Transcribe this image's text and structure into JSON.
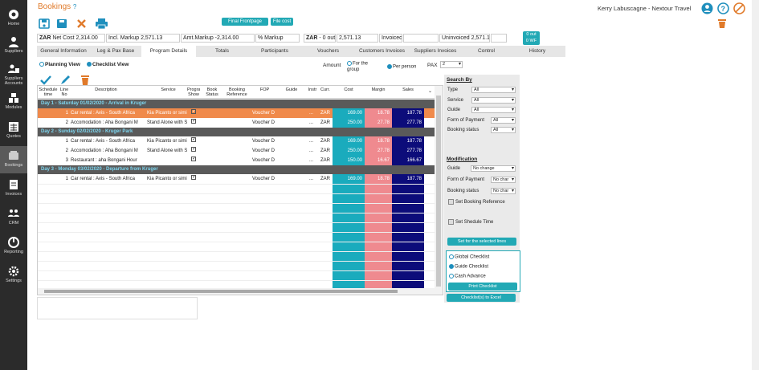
{
  "sidebar": {
    "items": [
      {
        "label": "Home",
        "icon": "home-icon"
      },
      {
        "label": "Suppliers",
        "icon": "suppliers-icon"
      },
      {
        "label": "Suppliers Accounts",
        "icon": "accounts-icon"
      },
      {
        "label": "Modules",
        "icon": "modules-icon"
      },
      {
        "label": "Quotes",
        "icon": "quotes-icon"
      },
      {
        "label": "Bookings",
        "icon": "bookings-icon"
      },
      {
        "label": "Invoices",
        "icon": "invoices-icon"
      },
      {
        "label": "CRM",
        "icon": "crm-icon"
      },
      {
        "label": "Reporting",
        "icon": "reporting-icon"
      },
      {
        "label": "Settings",
        "icon": "settings-icon"
      }
    ]
  },
  "header": {
    "title": "Bookings",
    "help": "?",
    "user": "Kerry Labuscagne - Nextour Travel",
    "final_frontpage": "Final Frontpage",
    "file_cost": "File cost"
  },
  "summary": {
    "currency": "ZAR",
    "net_cost": "Net Cost 2,314.00",
    "incl_markup": "Incl. Markup 2,571.13",
    "amt_markup": "Amt.Markup -2,314.00",
    "pct_markup": "% Markup",
    "currency2": "ZAR",
    "out": "- 0 out",
    "amount": "2,571.13",
    "invoiced": "Invoiced",
    "uninvoiced": "Uninvoiced 2,571.13",
    "badge1": "0 out",
    "badge2": "0 WF"
  },
  "tabs": [
    "General Information",
    "Leg & Pax Base",
    "Program Details",
    "Totals",
    "Participants",
    "Vouchers",
    "Customers Invoices",
    "Suppliers Invoices",
    "Control",
    "History"
  ],
  "options": {
    "planning": "Planning View",
    "checklist": "Checklist View",
    "amount": "Amount",
    "for_group": "For the group",
    "per_person": "Per person",
    "pax_label": "PAX",
    "pax_value": "2"
  },
  "grid": {
    "headers": {
      "sched": "Schedule time",
      "line": "Line No",
      "desc": "Description",
      "service": "Service",
      "program": "Program Show",
      "book": "Book Status",
      "ref": "Booking Reference",
      "fop": "FOP",
      "guide": "Guide",
      "instr": "Instr",
      "curr": "Curr.",
      "cost": "Cost",
      "margin": "Margin",
      "sales": "Sales"
    },
    "days": [
      {
        "title": "Day 1 - Saturday 01/02/2020 - Arrival in Kruger",
        "rows": [
          {
            "line": "1",
            "desc": "Car rental : Avis - South Africa",
            "service": "Kia Picanto or simil",
            "fop": "Voucher D",
            "instr": "...",
            "curr": "ZAR",
            "cost": "169.00",
            "margin": "18.78",
            "sales": "187.78",
            "selected": true
          },
          {
            "line": "2",
            "desc": "Accomodation : Aha Bongani M",
            "service": "Stand Alone with S",
            "fop": "Voucher D",
            "instr": "...",
            "curr": "ZAR",
            "cost": "250.00",
            "margin": "27.78",
            "sales": "277.78",
            "selected": false
          }
        ]
      },
      {
        "title": "Day 2 - Sunday 02/02/2020 - Kruger Park",
        "rows": [
          {
            "line": "1",
            "desc": "Car rental : Avis - South Africa",
            "service": "Kia Picanto or simil",
            "fop": "Voucher D",
            "instr": "...",
            "curr": "ZAR",
            "cost": "169.00",
            "margin": "18.78",
            "sales": "187.78",
            "selected": false
          },
          {
            "line": "2",
            "desc": "Accomodation : Aha Bongani M",
            "service": "Stand Alone with S",
            "fop": "Voucher D",
            "instr": "...",
            "curr": "ZAR",
            "cost": "250.00",
            "margin": "27.78",
            "sales": "277.78",
            "selected": false
          },
          {
            "line": "3",
            "desc": "Restaurant : aha Bongani Hour",
            "service": "",
            "fop": "Voucher D",
            "instr": "...",
            "curr": "ZAR",
            "cost": "150.00",
            "margin": "16.67",
            "sales": "166.67",
            "selected": false
          }
        ]
      },
      {
        "title": "Day 3 - Monday 03/02/2020 - Departure from Kruger",
        "rows": [
          {
            "line": "1",
            "desc": "Car rental : Avis - South Africa",
            "service": "Kia Picanto or simil",
            "fop": "Voucher D",
            "instr": "...",
            "curr": "ZAR",
            "cost": "169.00",
            "margin": "18.78",
            "sales": "187.78",
            "selected": false
          }
        ]
      }
    ]
  },
  "panel": {
    "search_by": "Search By",
    "type": "Type",
    "service": "Service",
    "guide": "Guide",
    "fop": "Form of Payment",
    "booking_status": "Booking status",
    "all": "All",
    "modification": "Modification",
    "mod_guide": "Guide",
    "no_change": "No change",
    "no_char": "No char",
    "set_booking_ref": "Set Booking Reference",
    "set_schedule": "Set Shedule Time",
    "set_selected": "Set for the selected lines",
    "global_checklist": "Global Checklist",
    "guide_checklist": "Guide Checklist",
    "cash_advance": "Cash Advance",
    "print_checklist": "Print Checklist",
    "checklist_excel": "Checklist(s) to Excel"
  }
}
